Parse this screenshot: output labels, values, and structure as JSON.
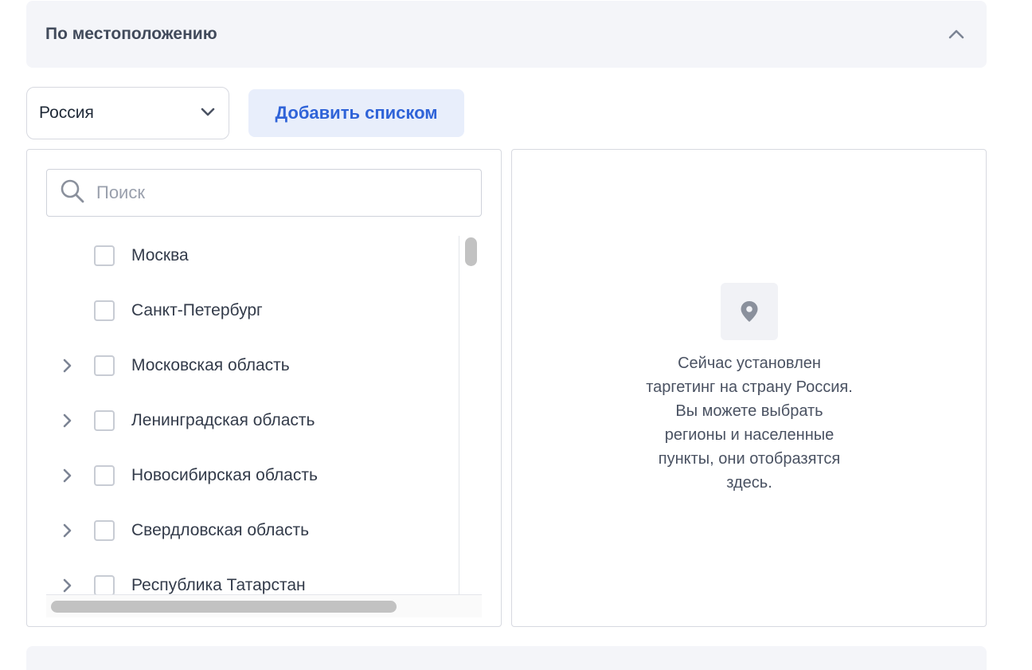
{
  "section": {
    "title": "По местоположению"
  },
  "country_select": {
    "value": "Россия"
  },
  "add_list_button": {
    "label": "Добавить списком"
  },
  "search": {
    "placeholder": "Поиск"
  },
  "regions": [
    {
      "label": "Москва",
      "expandable": false
    },
    {
      "label": "Санкт-Петербург",
      "expandable": false
    },
    {
      "label": "Московская область",
      "expandable": true
    },
    {
      "label": "Ленинградская область",
      "expandable": true
    },
    {
      "label": "Новосибирская область",
      "expandable": true
    },
    {
      "label": "Свердловская область",
      "expandable": true
    },
    {
      "label": "Республика Татарстан",
      "expandable": true
    }
  ],
  "empty_state": {
    "text": "Сейчас установлен\nтаргетинг на страну Россия.\nВы можете выбрать\nрегионы и населенные\nпункты, они отобразятся\nздесь."
  },
  "icons": {
    "collapse": "chevron-up-icon",
    "dropdown": "chevron-down-icon",
    "search": "search-icon",
    "expand": "chevron-right-icon",
    "location": "map-pin-icon"
  },
  "colors": {
    "accent": "#2f63d8",
    "accent_bg": "#e8eefb",
    "header_bg": "#f4f5f9"
  }
}
